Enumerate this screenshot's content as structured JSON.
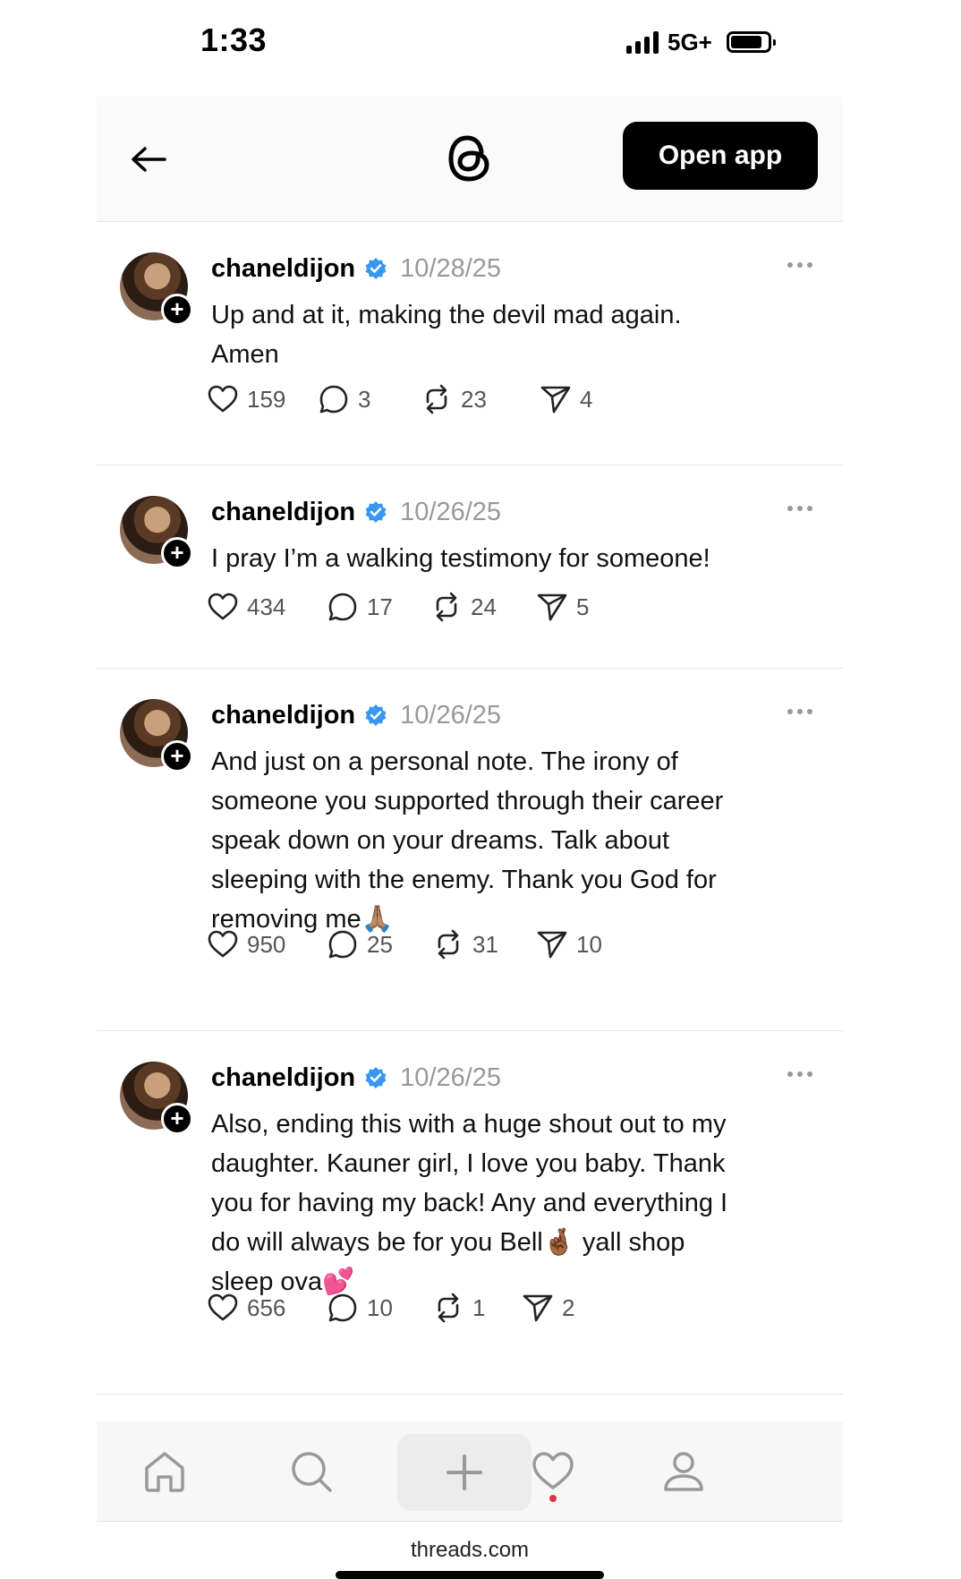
{
  "status_bar": {
    "time": "1:33",
    "network": "5G+"
  },
  "header": {
    "back_icon": "arrow-left-icon",
    "logo_icon": "threads-logo-icon",
    "open_app_label": "Open app"
  },
  "posts": [
    {
      "username": "chaneldijon",
      "verified": true,
      "date": "10/28/25",
      "text": "Up and at it, making the devil mad again.\nAmen",
      "likes": "159",
      "replies": "3",
      "reposts": "23",
      "shares": "4"
    },
    {
      "username": "chaneldijon",
      "verified": true,
      "date": "10/26/25",
      "text": "I pray I’m a walking testimony for someone!",
      "likes": "434",
      "replies": "17",
      "reposts": "24",
      "shares": "5"
    },
    {
      "username": "chaneldijon",
      "verified": true,
      "date": "10/26/25",
      "text": "And just on a personal note. The irony of\nsomeone you supported through their career\nspeak down on your dreams. Talk about\nsleeping with the enemy. Thank you God for\nremoving me🙏🏽",
      "likes": "950",
      "replies": "25",
      "reposts": "31",
      "shares": "10"
    },
    {
      "username": "chaneldijon",
      "verified": true,
      "date": "10/26/25",
      "text": "Also, ending this with a huge shout out to my\ndaughter. Kauner girl, I love you baby. Thank\nyou for having my back! Any and everything I\ndo will always be for you Bell🤞🏾 yall shop\nsleep ova💕",
      "likes": "656",
      "replies": "10",
      "reposts": "1",
      "shares": "2"
    }
  ],
  "bottom_nav": {
    "items": [
      "home-icon",
      "search-icon",
      "plus-icon",
      "heart-icon",
      "profile-icon"
    ],
    "notification_color": "#e0344a"
  },
  "browser": {
    "url": "threads.com"
  },
  "colors": {
    "verified_blue": "#3897f0",
    "muted_text": "#999999",
    "button_black": "#000000"
  }
}
